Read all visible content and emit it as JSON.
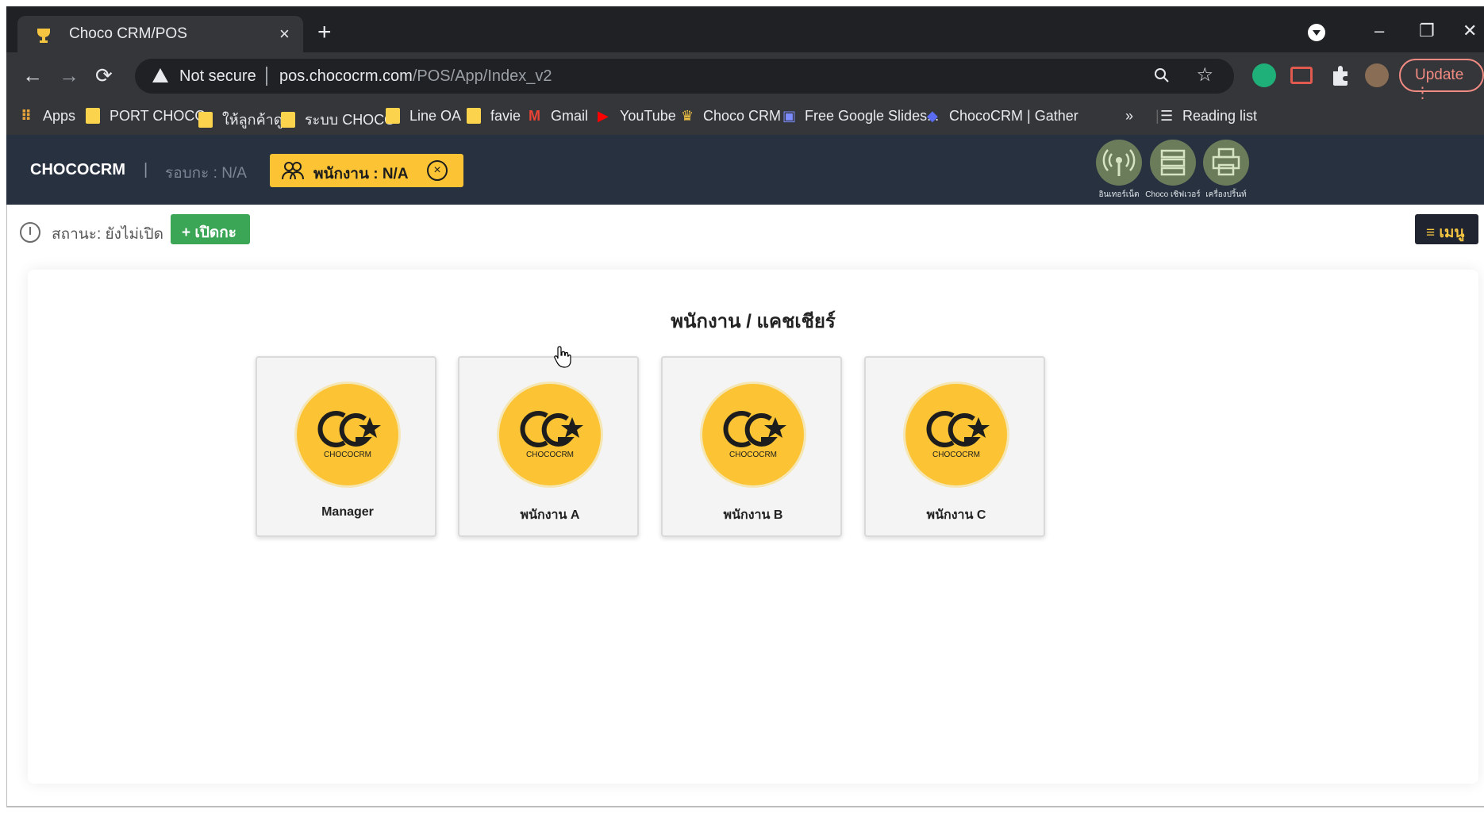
{
  "browser": {
    "tab_title": "Choco CRM/POS",
    "tab_close": "×",
    "new_tab": "+",
    "window_controls": {
      "minimize": "–",
      "restore": "❐",
      "close": "✕"
    },
    "security_label": "Not secure",
    "url_host": "pos.chococrm.com",
    "url_path": "/POS/App/Index_v2",
    "update_label": "Update",
    "bookmarks": [
      {
        "label": "Apps",
        "icon": "apps-grid-icon"
      },
      {
        "label": "PORT CHOCO",
        "icon": "folder-icon"
      },
      {
        "label": "ให้ลูกค้าดู",
        "icon": "folder-icon"
      },
      {
        "label": "ระบบ CHOCO",
        "icon": "folder-icon"
      },
      {
        "label": "Line OA",
        "icon": "folder-icon"
      },
      {
        "label": "favie",
        "icon": "folder-icon"
      },
      {
        "label": "Gmail",
        "icon": "gmail-icon"
      },
      {
        "label": "YouTube",
        "icon": "youtube-icon"
      },
      {
        "label": "Choco CRM",
        "icon": "choco-icon"
      },
      {
        "label": "Free Google Slides...",
        "icon": "slides-icon"
      },
      {
        "label": "ChocoCRM | Gather",
        "icon": "gather-icon"
      }
    ],
    "bookmarks_overflow": "»",
    "reading_list": "Reading list"
  },
  "app": {
    "brand": "CHOCOCRM",
    "separator": "|",
    "shift_label": "รอบกะ : N/A",
    "staff_label": "พนักงาน : N/A",
    "staff_clear": "×",
    "header_icons": [
      {
        "label": "อินเทอร์เน็ต",
        "icon": "antenna-icon"
      },
      {
        "label": "Choco เซิฟเวอร์",
        "icon": "server-icon"
      },
      {
        "label": "เครื่องปริ้นท์",
        "icon": "printer-icon"
      }
    ],
    "status_text": "สถานะ: ยังไม่เปิด",
    "open_shift_label": "+ เปิดกะ",
    "menu_label": "≡ เมนู"
  },
  "main": {
    "title": "พนักงาน / แคชเชียร์",
    "logo_text": "CHOCOCRM",
    "staff": [
      {
        "name": "Manager"
      },
      {
        "name": "พนักงาน A"
      },
      {
        "name": "พนักงาน B"
      },
      {
        "name": "พนักงาน C"
      }
    ]
  },
  "colors": {
    "accent_yellow": "#fcc434",
    "header_bg": "#28313f",
    "open_green": "#3aa656"
  }
}
